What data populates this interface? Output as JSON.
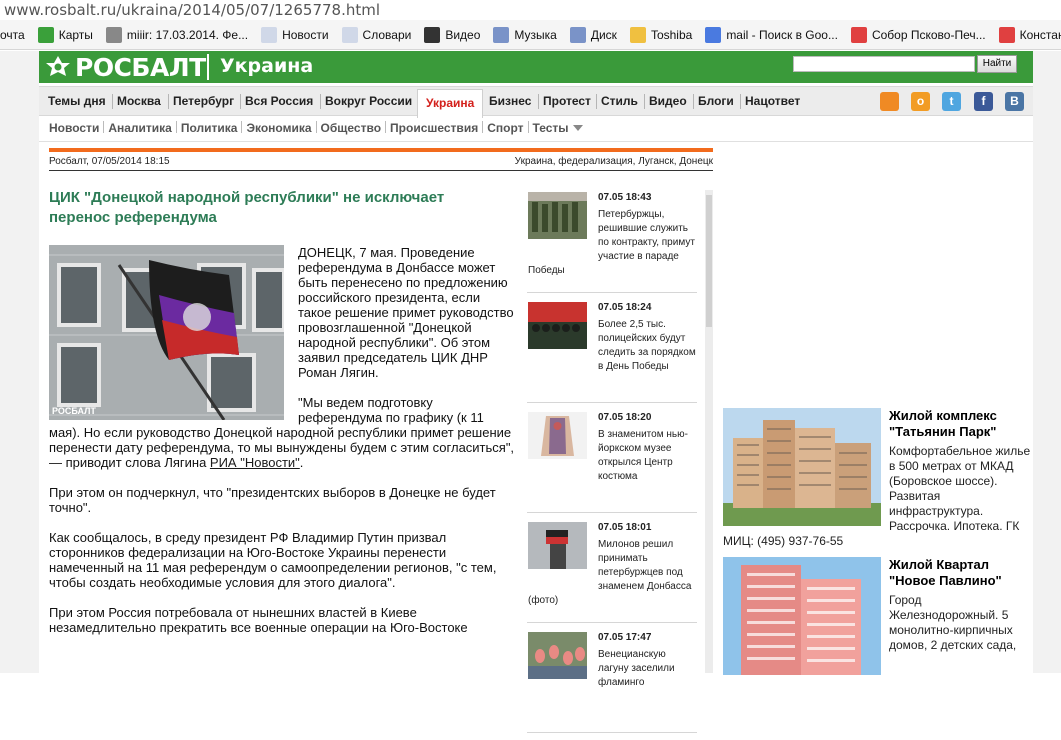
{
  "browser": {
    "url": "www.rosbalt.ru/ukraina/2014/05/07/1265778.html",
    "bookmarks": [
      {
        "label": "очта",
        "icon": "mail-icon",
        "color": "#ffffff"
      },
      {
        "label": "Карты",
        "icon": "maps-icon",
        "color": "#3aa03a"
      },
      {
        "label": "miiir: 17.03.2014. Фе...",
        "icon": "user-icon",
        "color": "#888888"
      },
      {
        "label": "Новости",
        "icon": "page-icon",
        "color": "#d0d8e8"
      },
      {
        "label": "Словари",
        "icon": "page-icon",
        "color": "#d0d8e8"
      },
      {
        "label": "Видео",
        "icon": "video-icon",
        "color": "#333333"
      },
      {
        "label": "Музыка",
        "icon": "music-icon",
        "color": "#7a93c8"
      },
      {
        "label": "Диск",
        "icon": "disk-icon",
        "color": "#7a93c8"
      },
      {
        "label": "Toshiba",
        "icon": "folder-icon",
        "color": "#f0c040"
      },
      {
        "label": "mail - Поиск в Goo...",
        "icon": "google-icon",
        "color": "#4a7ae0"
      },
      {
        "label": "Собор Псково-Печ...",
        "icon": "yandex-icon",
        "color": "#e04040"
      },
      {
        "label": "Констант",
        "icon": "yandex-icon",
        "color": "#e04040"
      }
    ]
  },
  "header": {
    "logo": "РОСБАЛТ",
    "section": "Украина",
    "search_placeholder": "",
    "search_button": "Найти"
  },
  "nav": {
    "items": [
      "Темы дня",
      "Москва",
      "Петербург",
      "Вся Россия",
      "Вокруг России",
      "Украина",
      "Бизнес",
      "Протест",
      "Стиль",
      "Видео",
      "Блоги",
      "Нацответ"
    ],
    "active": "Украина",
    "social": [
      {
        "name": "rss-icon",
        "glyph": "",
        "color": "#f08a24"
      },
      {
        "name": "odnoklassniki-icon",
        "glyph": "о",
        "color": "#f29c24"
      },
      {
        "name": "twitter-icon",
        "glyph": "t",
        "color": "#4fa6e0"
      },
      {
        "name": "facebook-icon",
        "glyph": "f",
        "color": "#3b5998"
      },
      {
        "name": "vkontakte-icon",
        "glyph": "В",
        "color": "#4a75a5"
      }
    ]
  },
  "subnav": {
    "items": [
      "Новости",
      "Аналитика",
      "Политика",
      "Экономика",
      "Общество",
      "Происшествия",
      "Спорт",
      "Тесты"
    ]
  },
  "article": {
    "source_date": "Росбалт, 07/05/2014 18:15",
    "tags": "Украина, федерализация, Луганск, Донецк",
    "title": "ЦИК \"Донецкой народной республики\" не исключает перенос референдума",
    "photo_watermark": "РОСБАЛТ",
    "p1": "ДОНЕЦК, 7 мая. Проведение референдума в Донбассе может быть перенесено по предложению российского президента, если такое решение примет руководство провозглашенной \"Донецкой народной республики\". Об этом заявил председатель ЦИК ДНР Роман Лягин.",
    "p2_start": "\"Мы ведем подготовку референдума по графику (к 11 мая). Но если руководство Донецкой народной республики примет решение перенести дату референдума, то мы вынуждены будем с этим согласиться\", — приводит слова Лягина ",
    "p2_link": "РИА \"Новости\"",
    "p2_end": ".",
    "p3": "При этом он подчеркнул, что \"президентских выборов в Донецке не будет точно\".",
    "p4": "Как сообщалось, в среду президент РФ Владимир Путин призвал сторонников федерализации на Юго-Востоке Украины перенести намеченный на 11 мая референдум о самоопределении регионов, \"с тем, чтобы создать необходимые условия для этого диалога\".",
    "p5": "При этом Россия потребовала от нынешних властей в Киеве незамедлительно прекратить все военные операции на Юго-Востоке"
  },
  "news": [
    {
      "time": "07.05 18:43",
      "text": "Петербуржцы, решившие служить по контракту, примут участие в параде Победы"
    },
    {
      "time": "07.05 18:24",
      "text": "Более 2,5 тыс. полицейских будут следить за порядком в День Победы"
    },
    {
      "time": "07.05 18:20",
      "text": "В знаменитом нью-йоркском музее открылся Центр костюма"
    },
    {
      "time": "07.05 18:01",
      "text": "Милонов решил принимать петербуржцев под знаменем Донбасса (фото)"
    },
    {
      "time": "07.05 17:47",
      "text": "Венецианскую лагуну заселили фламинго"
    }
  ],
  "ads": [
    {
      "title": "Жилой комплекс \"Татьянин Парк\"",
      "text": "Комфортабельное жилье в 500 метрах от МКАД (Боровское шоссе). Развитая инфраструктура. Рассрочка. Ипотека. ГК",
      "phone": "МИЦ: (495) 937-76-55"
    },
    {
      "title": "Жилой Квартал \"Новое Павлино\"",
      "text": "Город Железнодорожный. 5 монолитно-кирпичных домов, 2 детских сада,"
    }
  ]
}
